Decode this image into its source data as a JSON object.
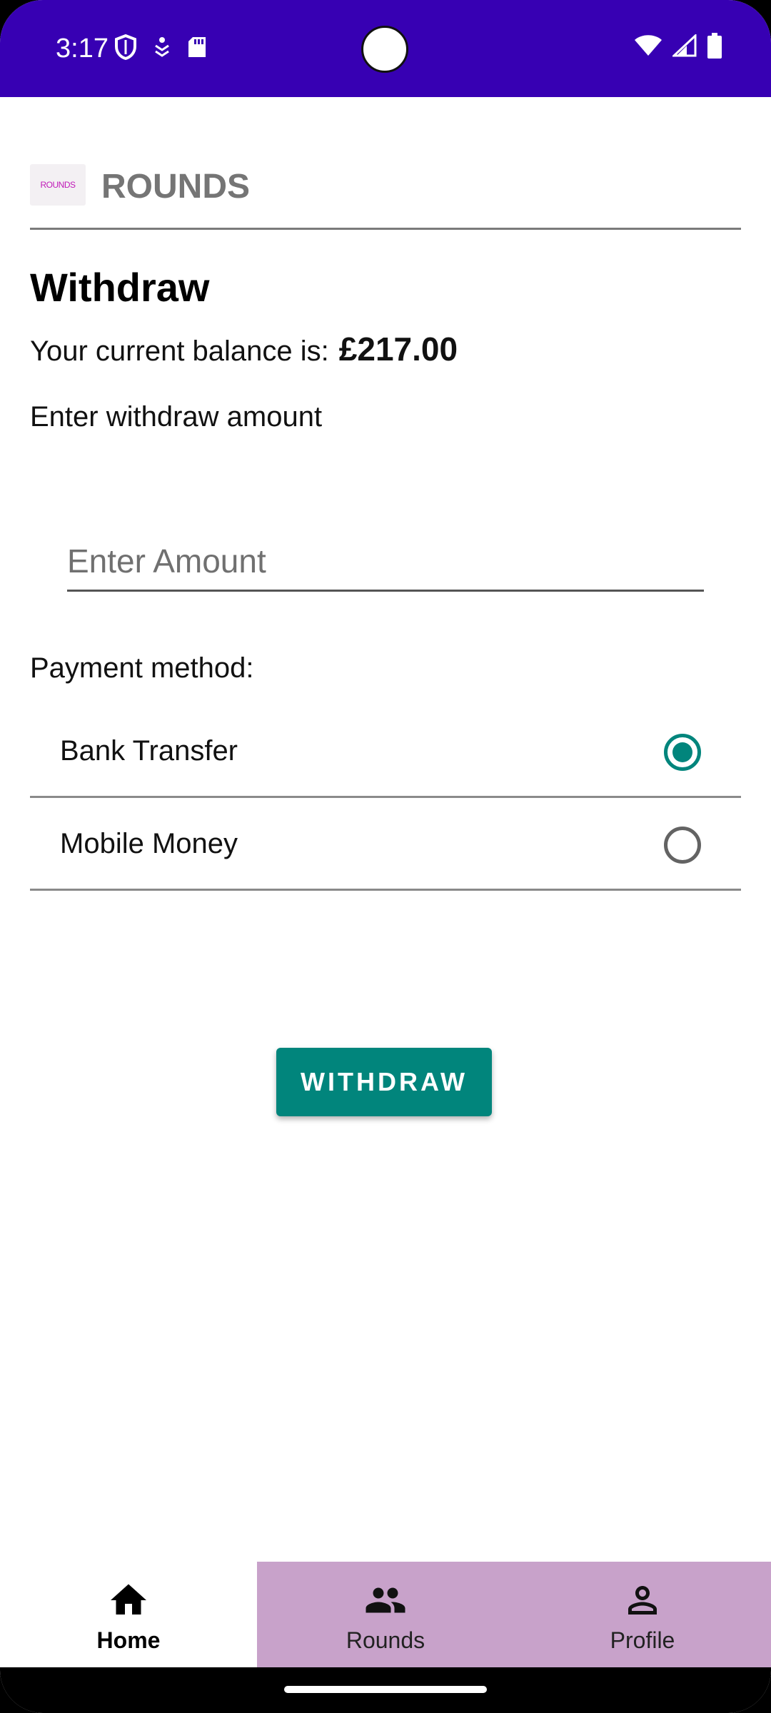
{
  "status_bar": {
    "time": "3:17",
    "left_icons": [
      "shield-icon",
      "stack-icon",
      "sd-card-icon"
    ],
    "right_icons": [
      "wifi-icon",
      "signal-icon",
      "battery-icon"
    ]
  },
  "header": {
    "logo_text": "ROUNDS",
    "title": "ROUNDS"
  },
  "withdraw": {
    "title": "Withdraw",
    "balance_label": "Your current balance is:",
    "balance_value": "£217.00",
    "amount_label": "Enter withdraw amount",
    "amount_placeholder": "Enter Amount",
    "amount_value": ""
  },
  "payment": {
    "label": "Payment method:",
    "options": [
      {
        "label": "Bank Transfer",
        "selected": true
      },
      {
        "label": "Mobile Money",
        "selected": false
      }
    ]
  },
  "actions": {
    "withdraw_label": "WITHDRAW"
  },
  "bottom_nav": {
    "items": [
      {
        "label": "Home",
        "icon": "home-icon",
        "active": true
      },
      {
        "label": "Rounds",
        "icon": "group-icon",
        "active": false
      },
      {
        "label": "Profile",
        "icon": "person-icon",
        "active": false
      }
    ]
  },
  "colors": {
    "status_bar": "#3700b3",
    "accent": "#01857c",
    "nav_inactive": "#c8a2ca"
  }
}
